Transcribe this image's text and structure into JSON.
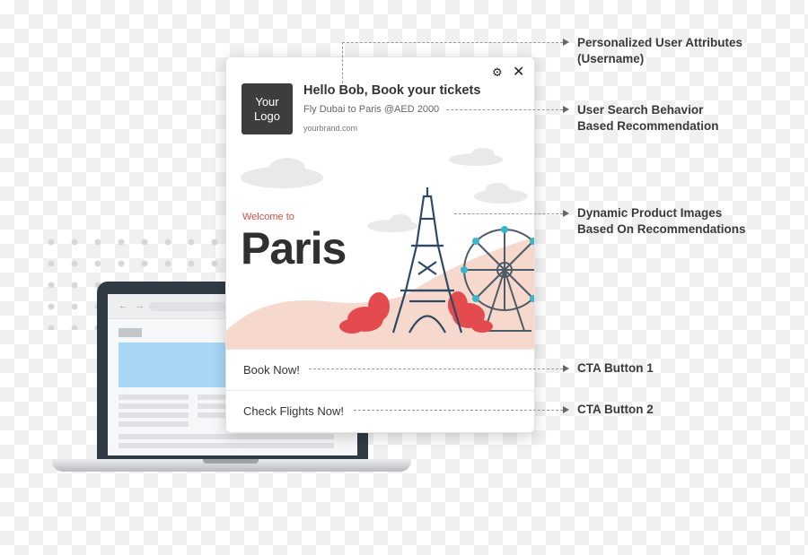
{
  "card": {
    "logo_line1": "Your",
    "logo_line2": "Logo",
    "title": "Hello Bob, Book your tickets",
    "subtitle": "Fly Dubai to Paris @AED 2000",
    "brand": "yourbrand.com",
    "gear_icon": "gear-icon",
    "close_icon": "close-icon",
    "close_glyph": "✕",
    "gear_glyph": "⚙",
    "banner": {
      "welcome": "Welcome to",
      "city": "Paris"
    },
    "cta1": "Book Now!",
    "cta2": "Check Flights Now!"
  },
  "annotations": [
    {
      "line1": "Personalized User Attributes",
      "line2": "(Username)"
    },
    {
      "line1": "User Search Behavior",
      "line2": "Based Recommendation"
    },
    {
      "line1": "Dynamic Product Images",
      "line2": "Based On Recommendations"
    },
    {
      "line1": "CTA Button 1"
    },
    {
      "line1": "CTA Button 2"
    }
  ],
  "laptop": {
    "nav_arrows": "← →"
  },
  "colors": {
    "accent_red": "#d94b43",
    "logo_bg": "#3d3d3d",
    "banner_ground": "#f6d9cc",
    "eiffel": "#2f4a64",
    "laptop_frame": "#2f3a44",
    "laptop_hero": "#a8d6f5"
  }
}
